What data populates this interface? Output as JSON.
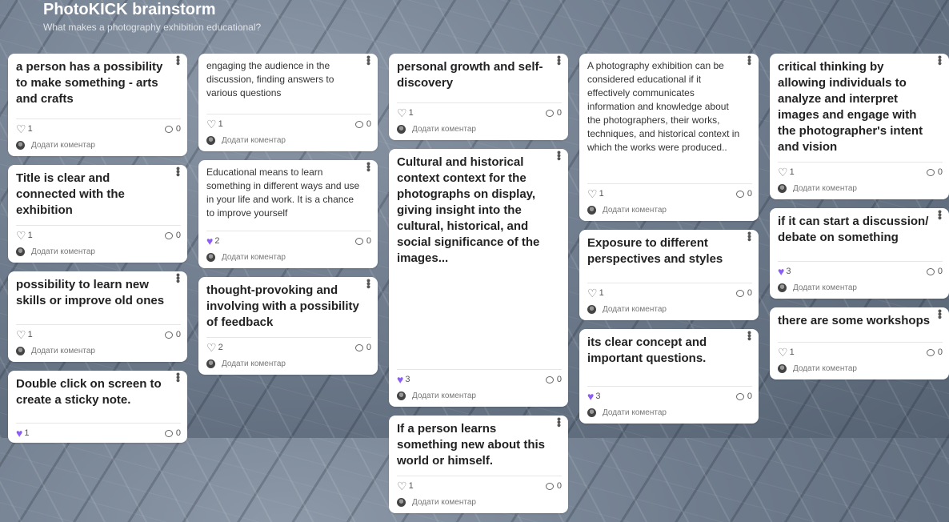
{
  "board": {
    "title": "PhotoKICK brainstorm",
    "subtitle": "What makes a photography exhibition educational?"
  },
  "comment_label": "Додати коментар",
  "colors": {
    "liked_heart": "#8b5cf6",
    "card_bg": "#ffffff"
  },
  "columns": [
    {
      "cards": [
        {
          "text": "a person has a possibility to make something - arts and crafts",
          "likes": "1",
          "comments": "0",
          "liked": false
        },
        {
          "text": "Title is clear and connected with the exhibition",
          "likes": "1",
          "comments": "0",
          "liked": false
        },
        {
          "text": "possibility to learn new skills or improve old ones",
          "likes": "1",
          "comments": "0",
          "liked": false
        },
        {
          "text": "Double click on screen to create a sticky note.",
          "likes": "1",
          "comments": "0",
          "liked": true
        }
      ]
    },
    {
      "cards": [
        {
          "text": "engaging the audience in the discussion, finding answers to various questions",
          "likes": "1",
          "comments": "0",
          "liked": false
        },
        {
          "text": "Educational means to learn something in different ways and use in your life and work. It is a chance to improve yourself",
          "likes": "2",
          "comments": "0",
          "liked": true
        },
        {
          "text": "thought-provoking and involving with a possibility of feedback",
          "likes": "2",
          "comments": "0",
          "liked": false
        }
      ]
    },
    {
      "cards": [
        {
          "text": "personal growth and self-discovery",
          "likes": "1",
          "comments": "0",
          "liked": false
        },
        {
          "text": "Cultural and historical context context for the photographs on display, giving insight into the cultural, historical, and social significance of the images...",
          "likes": "3",
          "comments": "0",
          "liked": true
        },
        {
          "text": "If a person learns something new about this world or himself.",
          "likes": "1",
          "comments": "0",
          "liked": false
        }
      ]
    },
    {
      "cards": [
        {
          "text": "A photography exhibition can be considered educational if it effectively communicates information and knowledge about the photographers, their works, techniques, and historical context in which the works were produced..",
          "likes": "1",
          "comments": "0",
          "liked": false
        },
        {
          "text": "Exposure to different perspectives and styles",
          "likes": "1",
          "comments": "0",
          "liked": false
        },
        {
          "text": "its clear concept and important questions.",
          "likes": "3",
          "comments": "0",
          "liked": true
        }
      ]
    },
    {
      "cards": [
        {
          "text": "critical thinking by allowing individuals to analyze and interpret images and engage with the photographer's intent and vision",
          "likes": "1",
          "comments": "0",
          "liked": false
        },
        {
          "text": "if it can start a discussion/ debate on something",
          "likes": "3",
          "comments": "0",
          "liked": true
        },
        {
          "text": "there are some workshops",
          "likes": "1",
          "comments": "0",
          "liked": false
        }
      ]
    }
  ]
}
